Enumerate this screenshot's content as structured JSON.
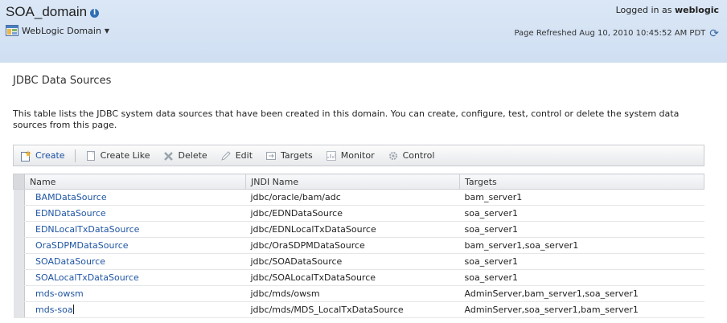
{
  "header": {
    "domain_name": "SOA_domain",
    "domain_menu_label": "WebLogic Domain",
    "logged_in_prefix": "Logged in as",
    "logged_in_user": "weblogic",
    "refresh_text": "Page Refreshed Aug 10, 2010 10:45:52 AM PDT",
    "refresh_icon": "refresh-icon"
  },
  "page": {
    "title": "JDBC Data Sources",
    "description": "This table lists the JDBC system data sources that have been created in this domain. You can create, configure, test, control or delete the system data sources from this page."
  },
  "toolbar": {
    "create": "Create",
    "create_like": "Create Like",
    "delete": "Delete",
    "edit": "Edit",
    "targets": "Targets",
    "monitor": "Monitor",
    "control": "Control"
  },
  "table": {
    "headers": {
      "name": "Name",
      "jndi": "JNDI Name",
      "targets": "Targets"
    },
    "rows": [
      {
        "name": "BAMDataSource",
        "jndi": "jdbc/oracle/bam/adc",
        "targets": "bam_server1"
      },
      {
        "name": "EDNDataSource",
        "jndi": "jdbc/EDNDataSource",
        "targets": "soa_server1"
      },
      {
        "name": "EDNLocalTxDataSource",
        "jndi": "jdbc/EDNLocalTxDataSource",
        "targets": "soa_server1"
      },
      {
        "name": "OraSDPMDataSource",
        "jndi": "jdbc/OraSDPMDataSource",
        "targets": "bam_server1,soa_server1"
      },
      {
        "name": "SOADataSource",
        "jndi": "jdbc/SOADataSource",
        "targets": "soa_server1"
      },
      {
        "name": "SOALocalTxDataSource",
        "jndi": "jdbc/SOALocalTxDataSource",
        "targets": "soa_server1"
      },
      {
        "name": "mds-owsm",
        "jndi": "jdbc/mds/owsm",
        "targets": "AdminServer,bam_server1,soa_server1"
      },
      {
        "name": "mds-soa",
        "jndi": "jdbc/mds/MDS_LocalTxDataSource",
        "targets": "AdminServer,soa_server1,bam_server1"
      }
    ]
  },
  "colors": {
    "header_bg": "#d4e2f4",
    "link": "#1f55a3",
    "accent": "#2f6fb4"
  }
}
